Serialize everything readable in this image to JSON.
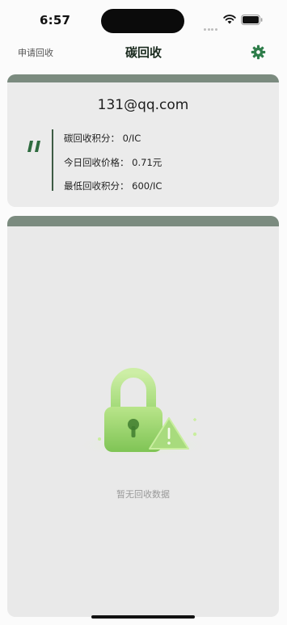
{
  "status_bar": {
    "time": "6:57"
  },
  "nav": {
    "left_label": "申请回收",
    "title": "碳回收",
    "settings_icon": "gear-icon"
  },
  "account": {
    "email": "131@qq.com",
    "lines": [
      "碳回收积分：  0/IC",
      "今日回收价格：  0.71元",
      "最低回收积分：  600/IC"
    ]
  },
  "list": {
    "empty_text": "暂无回收数据",
    "empty_icon": "lock-warning-icon"
  },
  "colors": {
    "accent": "#2e7d4a",
    "card_header": "#7b8b7f",
    "card_bg": "#ebebeb",
    "divider": "#3e5c45"
  }
}
